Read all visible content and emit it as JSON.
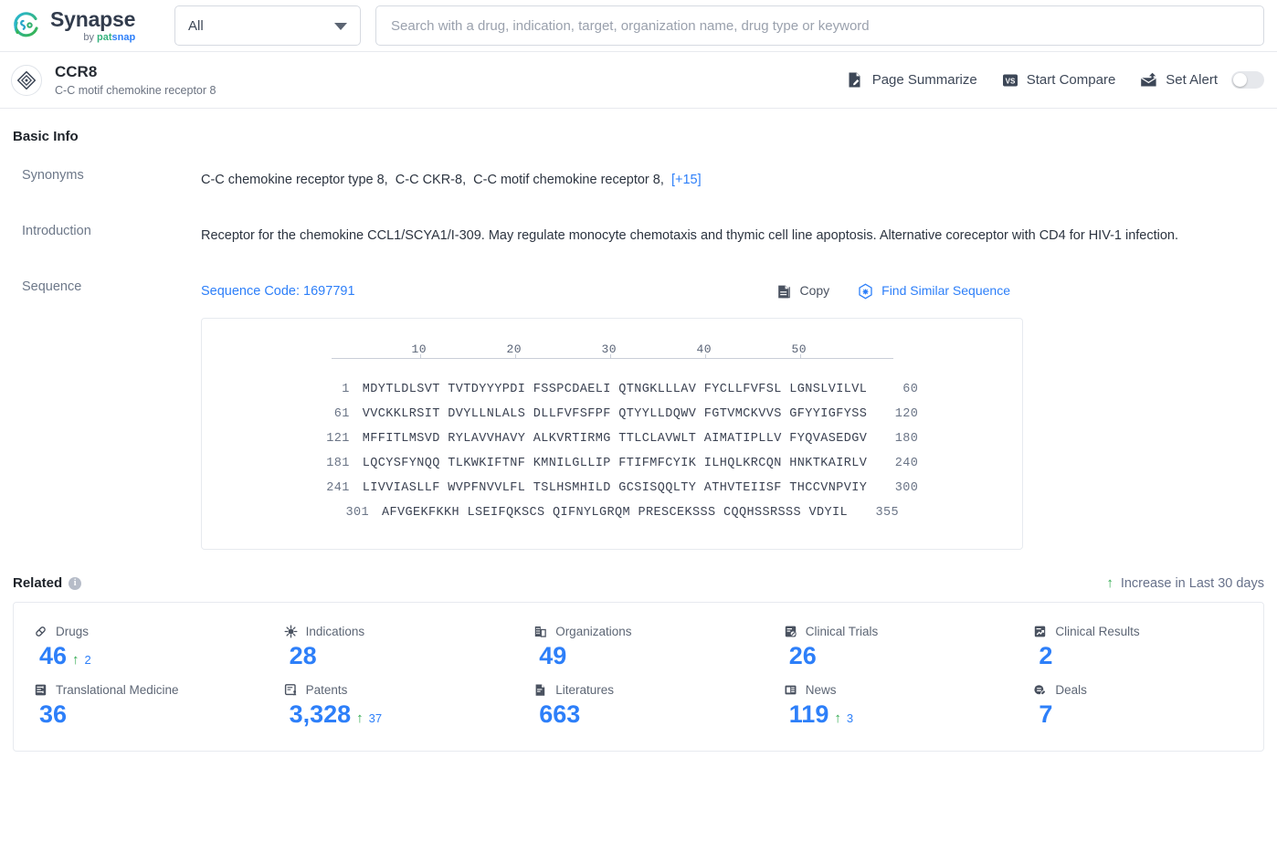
{
  "header": {
    "brand_name": "Synapse",
    "brand_sub_prefix": "by ",
    "brand_sub_pat": "pat",
    "brand_sub_snap": "snap",
    "scope_value": "All",
    "search_placeholder": "Search with a drug, indication, target, organization name, drug type or keyword",
    "search_value": ""
  },
  "entity": {
    "name": "CCR8",
    "description": "C-C motif chemokine receptor 8",
    "actions": [
      {
        "label": "Page Summarize",
        "icon": "page-summarize-icon"
      },
      {
        "label": "Start Compare",
        "icon": "versus-icon"
      },
      {
        "label": "Set Alert",
        "icon": "alert-mail-icon"
      }
    ],
    "alert_toggle_on": false
  },
  "basic_info": {
    "title": "Basic Info",
    "synonyms_label": "Synonyms",
    "synonyms": [
      "C-C chemokine receptor type 8",
      "C-C CKR-8",
      "C-C motif chemokine receptor 8"
    ],
    "synonyms_more": "[+15]",
    "introduction_label": "Introduction",
    "introduction": "Receptor for the chemokine CCL1/SCYA1/I-309. May regulate monocyte chemotaxis and thymic cell line apoptosis. Alternative coreceptor with CD4 for HIV-1 infection.",
    "sequence_label": "Sequence",
    "sequence_code": "Sequence Code: 1697791",
    "copy_label": "Copy",
    "find_similar_label": "Find Similar Sequence"
  },
  "sequence": {
    "ruler_ticks": [
      "10",
      "20",
      "30",
      "40",
      "50"
    ],
    "rows": [
      {
        "start": "1",
        "chunks": "MDYTLDLSVT TVTDYYYPDI FSSPCDAELI QTNGKLLLAV FYCLLFVFSL LGNSLVILVL",
        "end": "60"
      },
      {
        "start": "61",
        "chunks": "VVCKKLRSIT DVYLLNLALS DLLFVFSFPF QTYYLLDQWV FGTVMCKVVS GFYYIGFYSS",
        "end": "120"
      },
      {
        "start": "121",
        "chunks": "MFFITLMSVD RYLAVVHAVY ALKVRTIRMG TTLCLAVWLT AIMATIPLLV FYQVASEDGV",
        "end": "180"
      },
      {
        "start": "181",
        "chunks": "LQCYSFYNQQ TLKWKIFTNF KMNILGLLIP FTIFMFCYIK ILHQLKRCQN HNKTKAIRLV",
        "end": "240"
      },
      {
        "start": "241",
        "chunks": "LIVVIASLLF WVPFNVVLFL TSLHSMHILD GCSISQQLTY ATHVTEIISF THCCVNPVIY",
        "end": "300"
      },
      {
        "start": "301",
        "chunks": "AFVGEKFKKH LSEIFQKSCS QIFNYLGRQM PRESCEKSSS CQQHSSRSSS VDYIL",
        "end": "355"
      }
    ]
  },
  "related": {
    "title": "Related",
    "legend": "Increase in Last 30 days",
    "items": [
      {
        "label": "Drugs",
        "icon": "capsule-icon",
        "value": "46",
        "delta": "2"
      },
      {
        "label": "Indications",
        "icon": "virus-icon",
        "value": "28",
        "delta": ""
      },
      {
        "label": "Organizations",
        "icon": "building-icon",
        "value": "49",
        "delta": ""
      },
      {
        "label": "Clinical Trials",
        "icon": "clinical-trial-icon",
        "value": "26",
        "delta": ""
      },
      {
        "label": "Clinical Results",
        "icon": "clinical-result-icon",
        "value": "2",
        "delta": ""
      },
      {
        "label": "Translational Medicine",
        "icon": "translational-icon",
        "value": "36",
        "delta": ""
      },
      {
        "label": "Patents",
        "icon": "patent-icon",
        "value": "3,328",
        "delta": "37"
      },
      {
        "label": "Literatures",
        "icon": "literature-icon",
        "value": "663",
        "delta": ""
      },
      {
        "label": "News",
        "icon": "news-icon",
        "value": "119",
        "delta": "3"
      },
      {
        "label": "Deals",
        "icon": "deal-icon",
        "value": "7",
        "delta": ""
      }
    ]
  },
  "colors": {
    "accent_blue": "#2d7ff9",
    "increase_green": "#2faa4e",
    "icon_navy": "#3d4757"
  }
}
